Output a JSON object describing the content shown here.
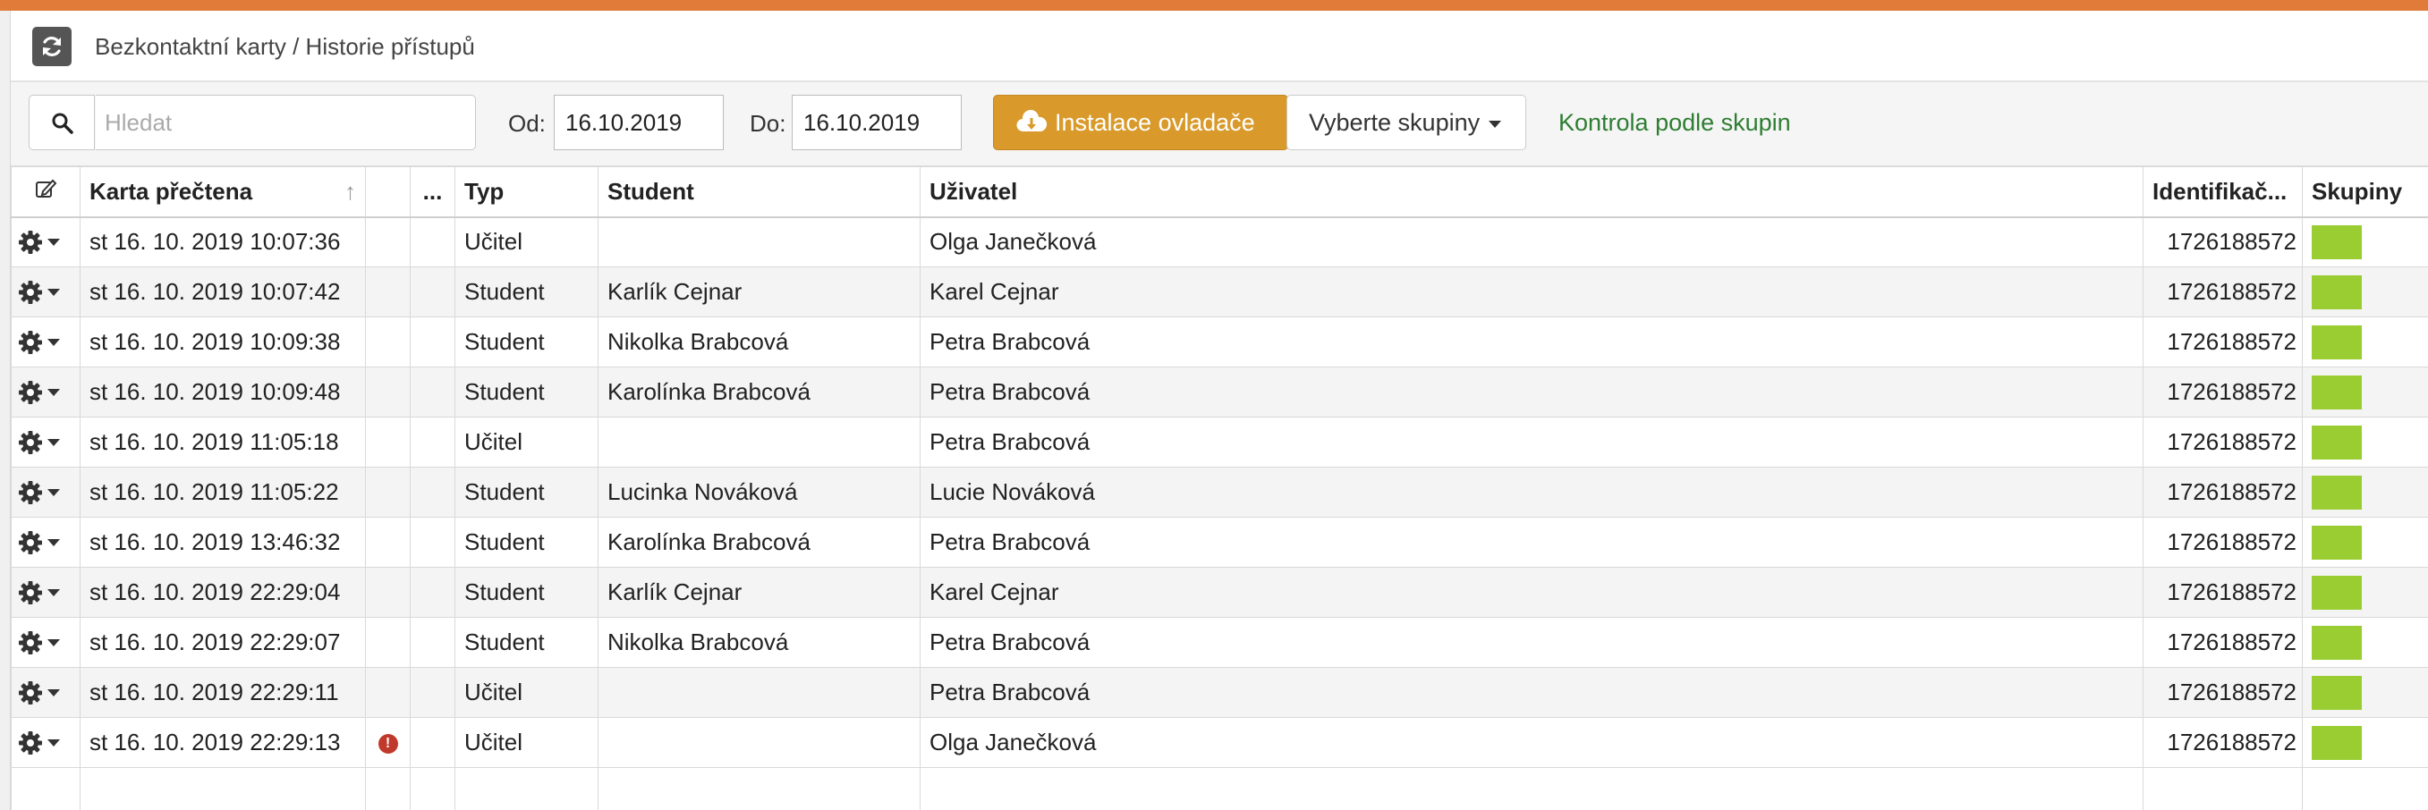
{
  "colors": {
    "accent_bar": "#e07b39",
    "install_button": "#d99a2b",
    "group_swatch": "#9acd32",
    "check_link": "#2e7d32",
    "error_icon": "#c0392b"
  },
  "header": {
    "breadcrumb": "Bezkontaktní karty / Historie přístupů",
    "refresh_icon": "refresh-icon"
  },
  "toolbar": {
    "search_placeholder": "Hledat",
    "from_label": "Od:",
    "from_value": "16.10.2019",
    "to_label": "Do:",
    "to_value": "16.10.2019",
    "install_label": "Instalace ovladače",
    "groups_label": "Vyberte skupiny",
    "check_link": "Kontrola podle skupin"
  },
  "table": {
    "columns": {
      "card_read": "Karta přečtena",
      "dots": "...",
      "type": "Typ",
      "student": "Student",
      "user": "Uživatel",
      "ident": "Identifikač...",
      "groups": "Skupiny"
    },
    "sort_arrow": "↑",
    "rows": [
      {
        "time": "st 16. 10. 2019 10:07:36",
        "type": "Učitel",
        "student": "",
        "user": "Olga Janečková",
        "ident": "1726188572"
      },
      {
        "time": "st 16. 10. 2019 10:07:42",
        "type": "Student",
        "student": "Karlík Cejnar",
        "user": "Karel Cejnar",
        "ident": "1726188572"
      },
      {
        "time": "st 16. 10. 2019 10:09:38",
        "type": "Student",
        "student": "Nikolka Brabcová",
        "user": "Petra Brabcová",
        "ident": "1726188572"
      },
      {
        "time": "st 16. 10. 2019 10:09:48",
        "type": "Student",
        "student": "Karolínka Brabcová",
        "user": "Petra Brabcová",
        "ident": "1726188572"
      },
      {
        "time": "st 16. 10. 2019 11:05:18",
        "type": "Učitel",
        "student": "",
        "user": "Petra Brabcová",
        "ident": "1726188572"
      },
      {
        "time": "st 16. 10. 2019 11:05:22",
        "type": "Student",
        "student": "Lucinka Nováková",
        "user": "Lucie Nováková",
        "ident": "1726188572"
      },
      {
        "time": "st 16. 10. 2019 13:46:32",
        "type": "Student",
        "student": "Karolínka Brabcová",
        "user": "Petra Brabcová",
        "ident": "1726188572"
      },
      {
        "time": "st 16. 10. 2019 22:29:04",
        "type": "Student",
        "student": "Karlík Cejnar",
        "user": "Karel Cejnar",
        "ident": "1726188572"
      },
      {
        "time": "st 16. 10. 2019 22:29:07",
        "type": "Student",
        "student": "Nikolka Brabcová",
        "user": "Petra Brabcová",
        "ident": "1726188572"
      },
      {
        "time": "st 16. 10. 2019 22:29:11",
        "type": "Učitel",
        "student": "",
        "user": "Petra Brabcová",
        "ident": "1726188572"
      },
      {
        "time": "st 16. 10. 2019 22:29:13",
        "type": "Učitel",
        "student": "",
        "user": "Olga Janečková",
        "ident": "1726188572",
        "error": "!"
      }
    ]
  }
}
